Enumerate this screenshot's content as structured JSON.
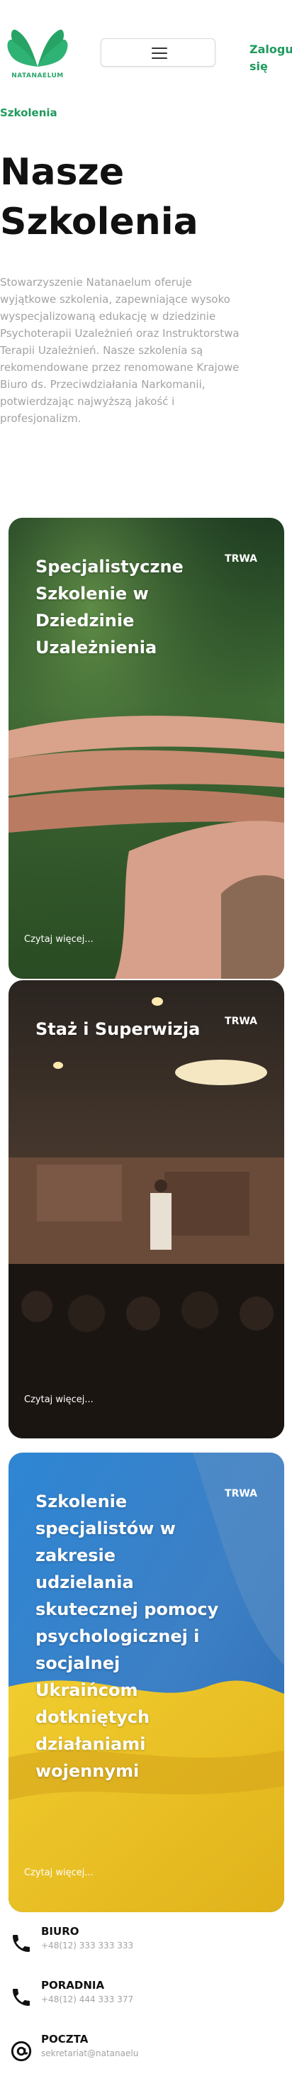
{
  "header": {
    "logo_text": "NATANAELUM",
    "login_label": "Zaloguj się"
  },
  "breadcrumb": "Szkolenia",
  "page_title": {
    "line1": "Nasze",
    "line2": "Szkolenia"
  },
  "intro": "Stowarzyszenie Natanaelum oferuje wyjątkowe szkolenia, zapewniające wysoko wyspecjalizowaną edukację w dziedzinie Psychoterapii Uzależnień oraz Instruktorstwa Terapii Uzależnień. Nasze szkolenia są rekomendowane przez renomowane Krajowe Biuro ds. Przeciwdziałania Narkomanii, potwierdzając najwyższą jakość i profesjonalizm.",
  "cards": [
    {
      "title": "Specjalistyczne Szkolenie w Dziedzinie Uzależnienia",
      "status": "TRWA",
      "read_more": "Czytaj więcej..."
    },
    {
      "title": "Staż i Superwizja",
      "status": "TRWA",
      "read_more": "Czytaj więcej..."
    },
    {
      "title": "Szkolenie specjalistów w zakresie udzielania skutecznej pomocy psychologicznej i socjalnej Ukraińcom dotkniętych działaniami wojennymi",
      "status": "TRWA",
      "read_more": "Czytaj więcej..."
    }
  ],
  "contacts": [
    {
      "label": "BIURO",
      "value": "+48(12) 333 333 333",
      "icon": "phone-icon"
    },
    {
      "label": "PORADNIA",
      "value": "+48(12) 444 333 377",
      "icon": "phone-icon"
    },
    {
      "label": "POCZTA",
      "value": "sekretariat@natanaelu",
      "icon": "at-icon"
    }
  ],
  "colors": {
    "brand_green": "#1f9a5d",
    "text_dark": "#111111",
    "text_muted": "#a3a3a3"
  }
}
